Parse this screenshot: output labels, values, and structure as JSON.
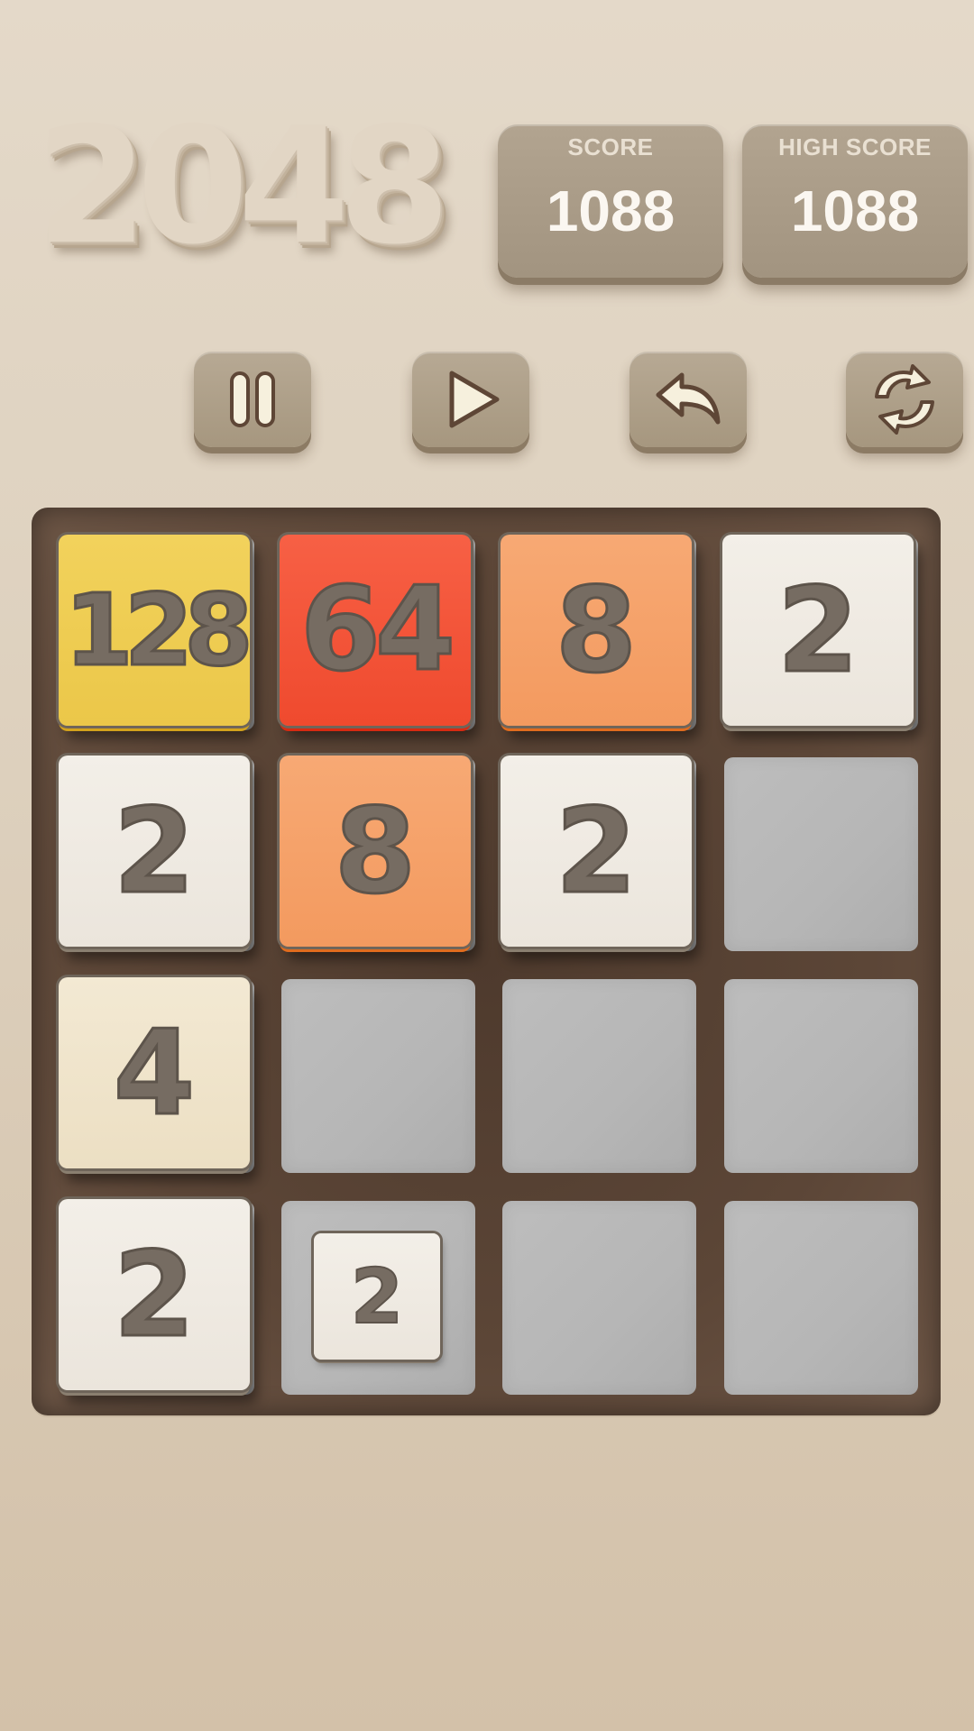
{
  "game": {
    "title": "2048"
  },
  "scoreboard": {
    "score_label": "SCORE",
    "score_value": "1088",
    "high_label": "HIGH SCORE",
    "high_value": "1088"
  },
  "controls": {
    "pause_icon": "pause-icon",
    "play_icon": "play-icon",
    "undo_icon": "undo-icon",
    "restart_icon": "restart-icon"
  },
  "board": {
    "size": 4,
    "rows": [
      [
        "128",
        "64",
        "8",
        "2"
      ],
      [
        "2",
        "8",
        "2",
        ""
      ],
      [
        "4",
        "",
        "",
        ""
      ],
      [
        "2",
        "2",
        "",
        ""
      ]
    ],
    "spawning_tile": {
      "row": 3,
      "col": 1,
      "value": "2"
    }
  },
  "colors": {
    "background": "#ddd0bd",
    "board": "#5c4637",
    "empty_cell": "#b8b8b8",
    "tile_2": "#efeae2",
    "tile_4": "#efe3c9",
    "tile_8": "#f5a26a",
    "tile_64": "#f3543a",
    "tile_128": "#eecd52",
    "tile_text": "#766c62"
  }
}
